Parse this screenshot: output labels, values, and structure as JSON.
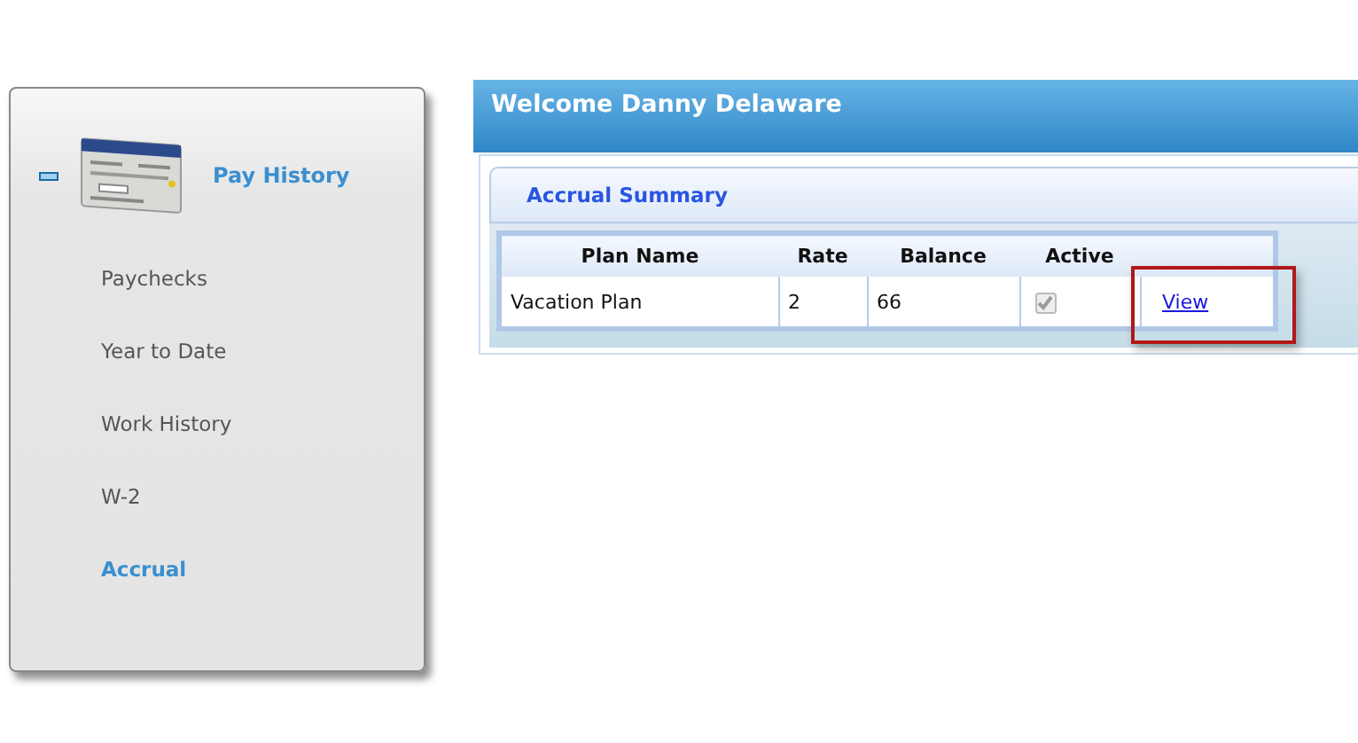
{
  "sidebar": {
    "section": {
      "label": "Pay History",
      "expanded": true
    },
    "items": [
      {
        "label": "Paychecks",
        "selected": false
      },
      {
        "label": "Year to Date",
        "selected": false
      },
      {
        "label": "Work History",
        "selected": false
      },
      {
        "label": "W-2",
        "selected": false
      },
      {
        "label": "Accrual",
        "selected": true
      }
    ]
  },
  "header": {
    "title": "Welcome Danny Delaware"
  },
  "panel": {
    "title": "Accrual Summary",
    "table": {
      "columns": [
        "Plan Name",
        "Rate",
        "Balance",
        "Active"
      ],
      "rows": [
        {
          "plan_name": "Vacation Plan",
          "rate": "2",
          "balance": "66",
          "active": true,
          "action": "View",
          "highlighted": true
        }
      ]
    }
  }
}
